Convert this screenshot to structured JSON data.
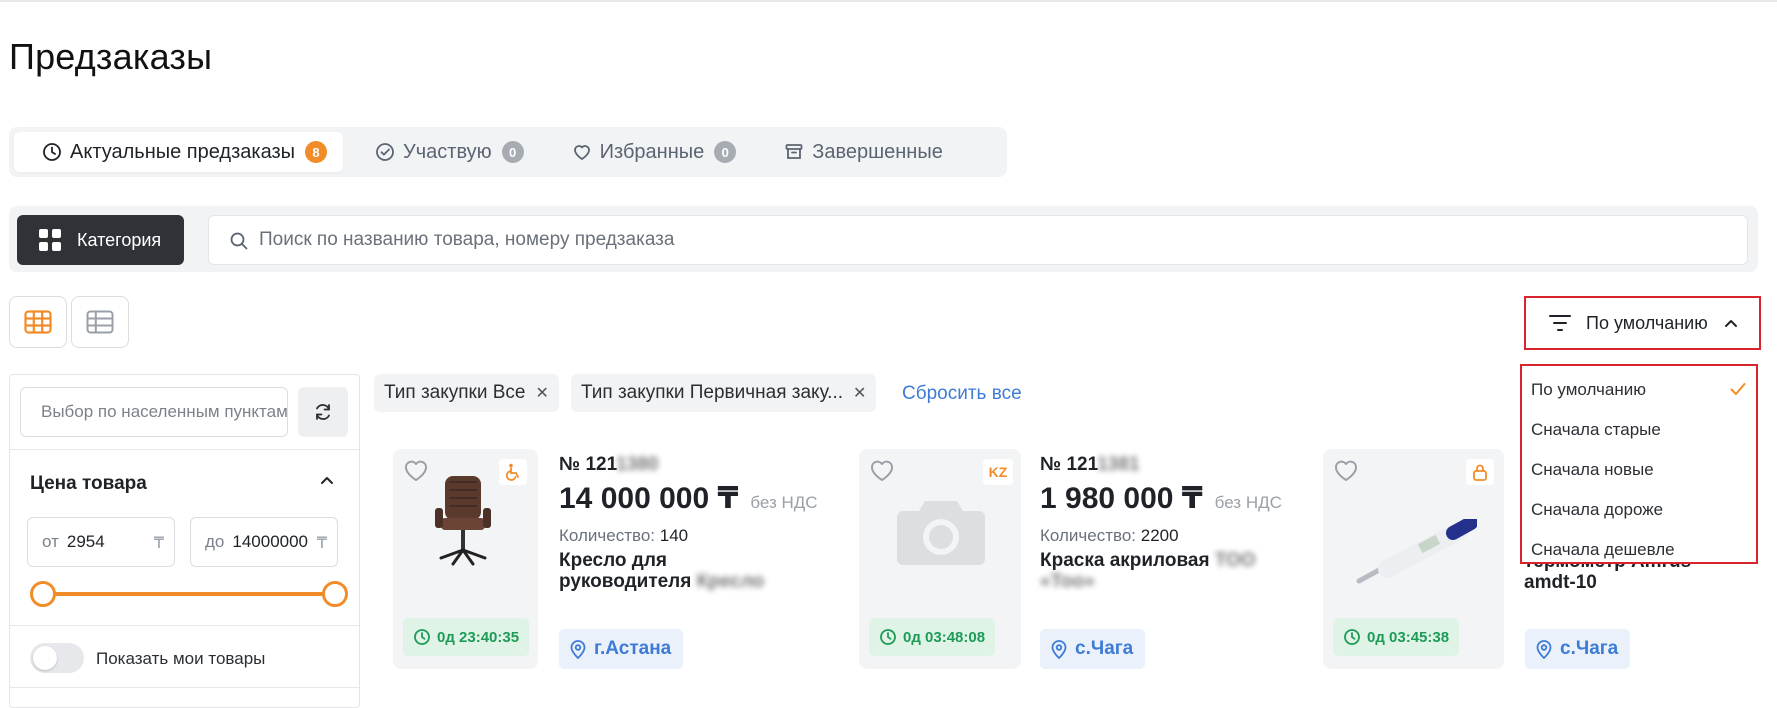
{
  "page": {
    "title": "Предзаказы"
  },
  "tabs": [
    {
      "label": "Актуальные предзаказы",
      "badge": "8",
      "icon": "clock-icon"
    },
    {
      "label": "Участвую",
      "badge": "0",
      "icon": "check-circle-icon"
    },
    {
      "label": "Избранные",
      "badge": "0",
      "icon": "heart-icon"
    },
    {
      "label": "Завершенные",
      "badge": "",
      "icon": "archive-icon"
    }
  ],
  "toolbar": {
    "category_label": "Категория",
    "search_placeholder": "Поиск по названию товара, номеру предзаказа"
  },
  "sort": {
    "current": "По умолчанию",
    "options": [
      "По умолчанию",
      "Сначала старые",
      "Сначала новые",
      "Сначала дороже",
      "Сначала дешевле"
    ],
    "selected_index": 0
  },
  "filters": {
    "location_placeholder": "Выбор по населенным пунктам",
    "price_title": "Цена товара",
    "price_from_prefix": "от",
    "price_from": "2954",
    "price_to_prefix": "до",
    "price_to": "14000000",
    "currency": "₸",
    "show_mine_label": "Показать мои товары"
  },
  "chips": [
    {
      "label": "Тип закупки Все"
    },
    {
      "label": "Тип закупки Первичная заку..."
    }
  ],
  "reset_all": "Сбросить все",
  "cards": [
    {
      "number_prefix": "№ 121",
      "number_hidden": "1380",
      "price": "14 000 000 ₸",
      "vat": "без НДС",
      "qty_label": "Количество:",
      "qty": "140",
      "name_line1": "Кресло для",
      "name_line2": "руководителя",
      "name_hidden": "Кресло",
      "timer": "0д 23:40:35",
      "location": "г.Астана"
    },
    {
      "number_prefix": "№ 121",
      "number_hidden": "1381",
      "price": "1 980 000 ₸",
      "vat": "без НДС",
      "qty_label": "Количество:",
      "qty": "2200",
      "name_line1": "Краска акриловая",
      "name_line2": "",
      "name_hidden": "ТОО «Тоо»",
      "timer": "0д 03:48:08",
      "location": "с.Чага",
      "corner_badge": "KZ"
    },
    {
      "name_line1": "термометр Amrus",
      "name_line2": "amdt-10",
      "timer": "0д 03:45:38",
      "location": "с.Чага"
    }
  ]
}
